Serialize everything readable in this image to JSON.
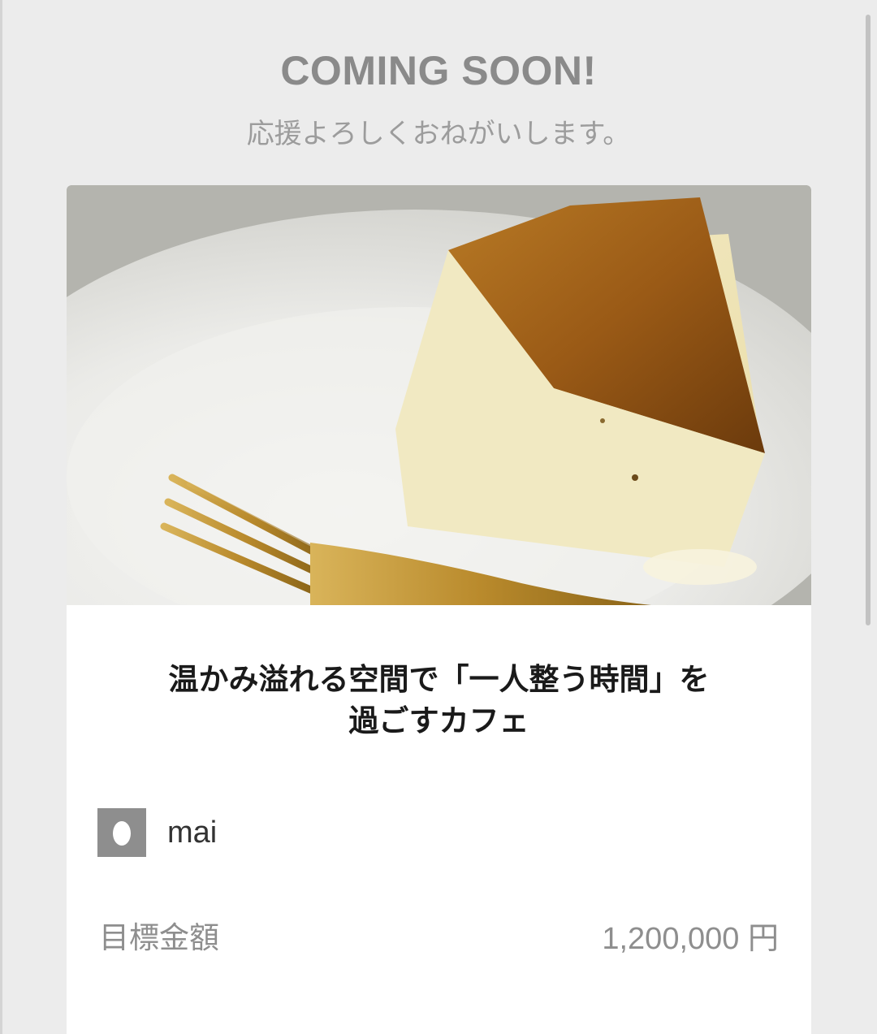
{
  "header": {
    "title": "COMING SOON!",
    "subtitle": "応援よろしくおねがいします。"
  },
  "project": {
    "image_alt": "cheesecake-photo",
    "title_line1": "温かみ溢れる空間で「一人整う時間」を",
    "title_line2": "過ごすカフェ",
    "owner_name": "mai",
    "goal_label": "目標金額",
    "goal_amount": "1,200,000",
    "goal_unit": "円"
  },
  "icons": {
    "avatar": "user-avatar-icon"
  },
  "colors": {
    "background": "#ececec",
    "card": "#ffffff",
    "heading_gray": "#8a8a8a",
    "text_dark": "#1a1a1a"
  }
}
